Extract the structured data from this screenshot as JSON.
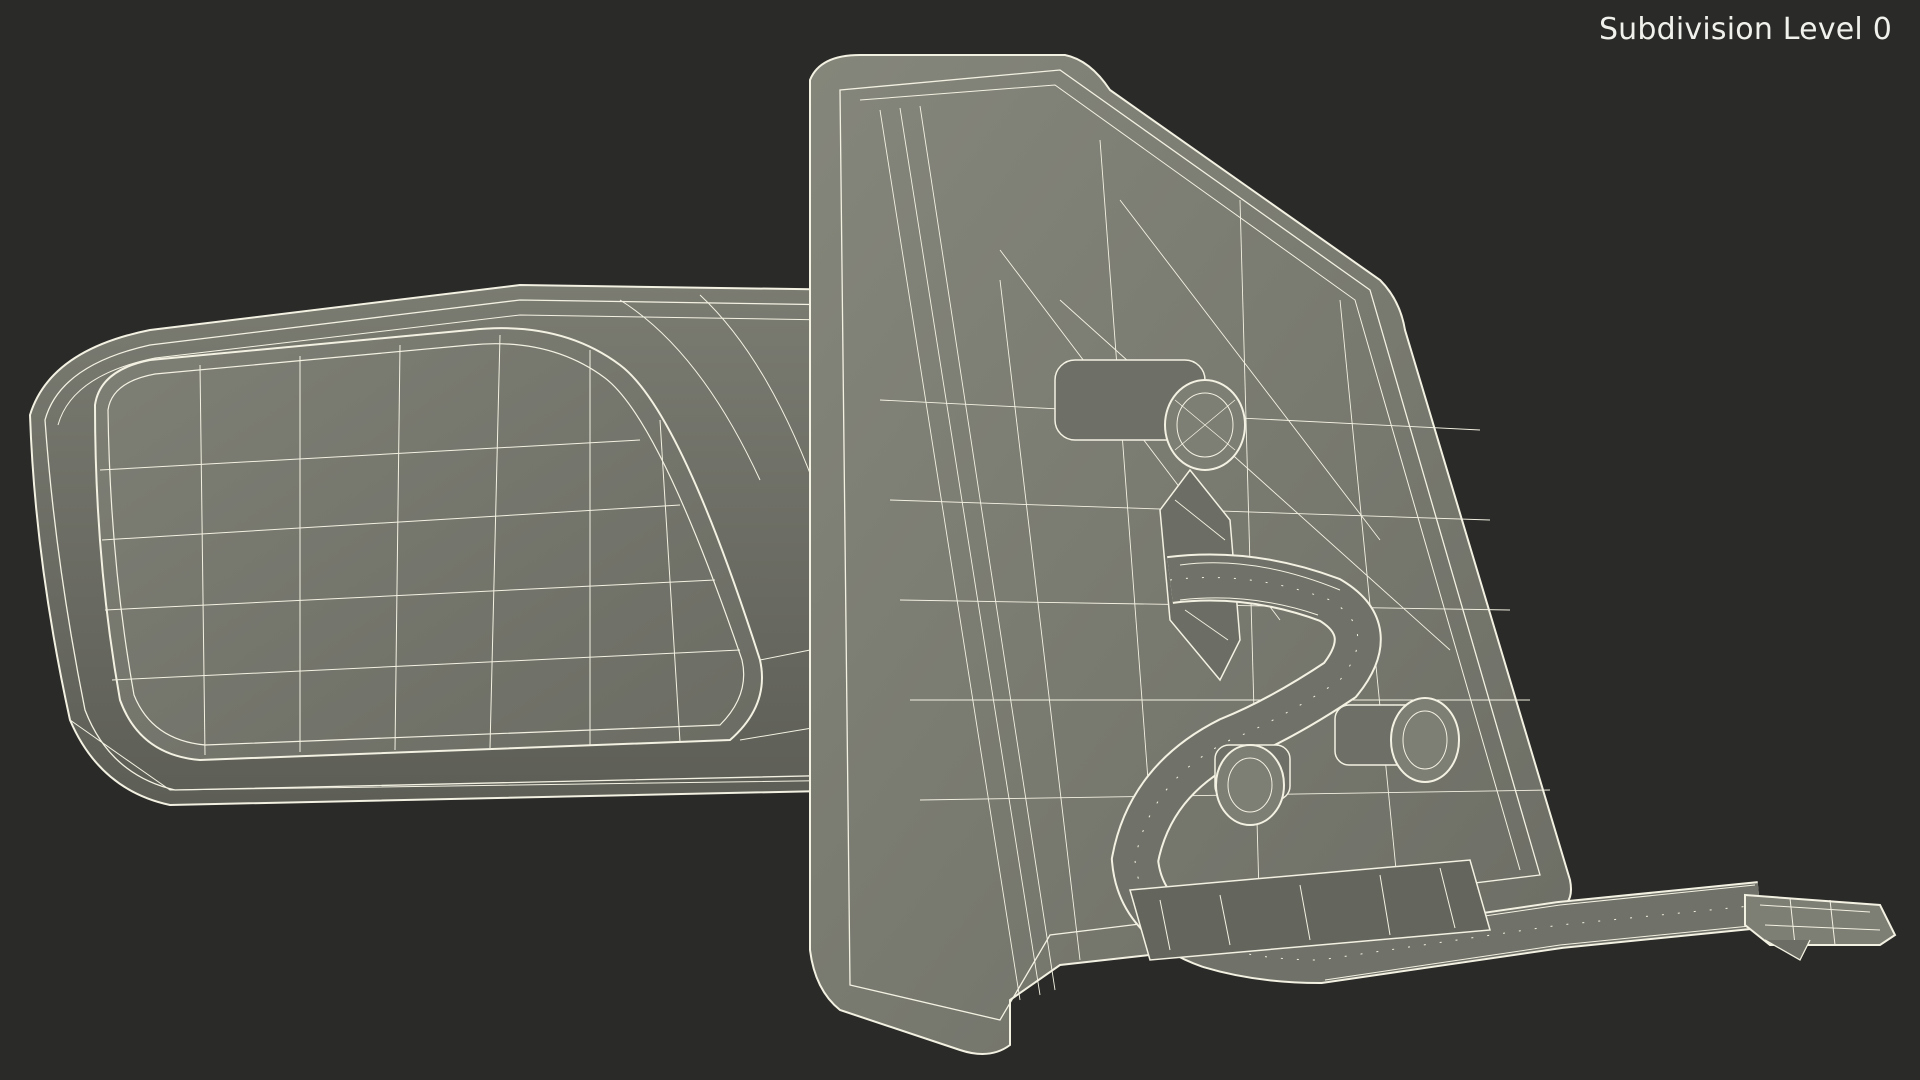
{
  "overlay": {
    "subdivision_label": "Subdivision Level 0"
  },
  "render": {
    "background_color": "#2a2a28",
    "surface_color": "#7b7c72",
    "surface_dark_color": "#5f6058",
    "wire_color": "#f3f1e2"
  }
}
